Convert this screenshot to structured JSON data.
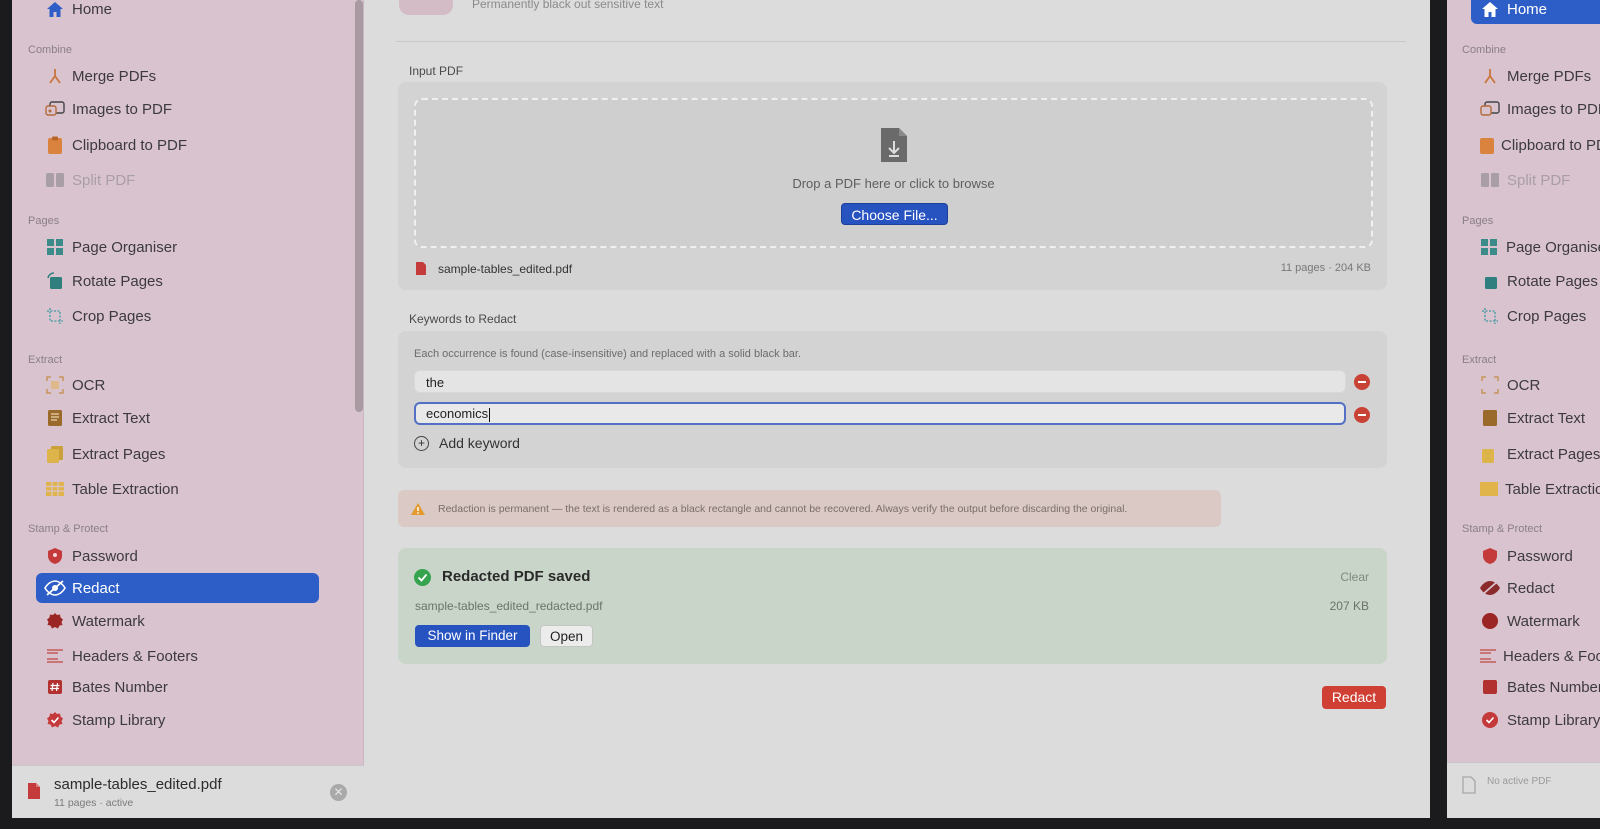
{
  "sidebar": {
    "home": "Home",
    "sections": {
      "combine": "Combine",
      "pages": "Pages",
      "extract": "Extract",
      "stamp": "Stamp & Protect"
    },
    "items": {
      "merge": "Merge PDFs",
      "images": "Images to PDF",
      "clipboard": "Clipboard to PDF",
      "split": "Split PDF",
      "organiser": "Page Organiser",
      "rotate": "Rotate Pages",
      "crop": "Crop Pages",
      "ocr": "OCR",
      "extract_text": "Extract Text",
      "extract_pages": "Extract Pages",
      "table": "Table Extraction",
      "password": "Password",
      "redact": "Redact",
      "watermark": "Watermark",
      "headers": "Headers & Footers",
      "bates": "Bates Number",
      "stamp_library": "Stamp Library"
    },
    "footer": {
      "file_name": "sample-tables_edited.pdf",
      "file_status": "11 pages · active"
    }
  },
  "header": {
    "description": "Permanently black out sensitive text"
  },
  "input_pdf": {
    "label": "Input PDF",
    "drop_text": "Drop a PDF here or click to browse",
    "choose_button": "Choose File...",
    "file_name": "sample-tables_edited.pdf",
    "file_meta": "11 pages · 204 KB"
  },
  "keywords": {
    "label": "Keywords to Redact",
    "note": "Each occurrence is found (case-insensitive) and replaced with a solid black bar.",
    "items": [
      "the",
      "economics"
    ],
    "add_label": "Add keyword"
  },
  "warning": {
    "text": "Redaction is permanent — the text is rendered as a black rectangle and cannot be recovered. Always verify the output before discarding the original."
  },
  "result": {
    "title": "Redacted PDF saved",
    "clear": "Clear",
    "file_name": "sample-tables_edited_redacted.pdf",
    "size": "207 KB",
    "show_in_finder": "Show in Finder",
    "open": "Open"
  },
  "actions": {
    "redact_button": "Redact"
  },
  "second_window": {
    "home": "Home",
    "sections": {
      "combine": "Combine",
      "pages": "Pages",
      "extract": "Extract",
      "stamp": "Stamp & Protect"
    },
    "items": {
      "merge": "Merge PDFs",
      "images": "Images to PDF",
      "clipboard": "Clipboard to PDF",
      "split": "Split PDF",
      "organiser": "Page Organiser",
      "rotate": "Rotate Pages",
      "crop": "Crop Pages",
      "ocr": "OCR",
      "extract_text": "Extract Text",
      "extract_pages": "Extract Pages",
      "table": "Table Extraction",
      "password": "Password",
      "redact": "Redact",
      "watermark": "Watermark",
      "headers": "Headers & Footers",
      "bates": "Bates Number",
      "stamp_library": "Stamp Library"
    },
    "footer_text": "No active PDF"
  },
  "colors": {
    "accent": "#2d5ec7",
    "danger": "#cf3f33",
    "success": "#36a34f",
    "sidebar_bg": "#d9c3ce"
  }
}
